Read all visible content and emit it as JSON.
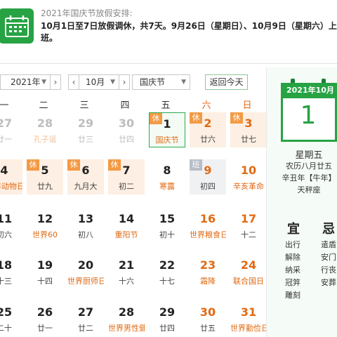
{
  "notice": {
    "title": "2021年国庆节放假安排:",
    "body": "10月1日至7日放假调休，共7天。9月26日（星期日）、10月9日（星期六）上班。"
  },
  "toolbar": {
    "year": "2021年",
    "month": "10月",
    "holiday": "国庆节",
    "today_label": "返回今天",
    "prev": "‹",
    "next": "›"
  },
  "weekdays": [
    "一",
    "二",
    "三",
    "四",
    "五",
    "六",
    "日"
  ],
  "weeks": [
    [
      {
        "day": "27",
        "lunar": "廿一",
        "dim": true
      },
      {
        "day": "28",
        "lunar": "孔子诞",
        "dim": true,
        "fest": true
      },
      {
        "day": "29",
        "lunar": "廿三",
        "dim": true
      },
      {
        "day": "30",
        "lunar": "廿四",
        "dim": true
      },
      {
        "day": "1",
        "lunar": "国庆节",
        "fest": true,
        "tag": "休",
        "today": true
      },
      {
        "day": "2",
        "lunar": "廿六",
        "tag": "休",
        "weekend": true
      },
      {
        "day": "3",
        "lunar": "廿七",
        "tag": "休",
        "weekend": true
      }
    ],
    [
      {
        "day": "4",
        "lunar": "世界动物日",
        "fest": true,
        "tag": "休"
      },
      {
        "day": "5",
        "lunar": "廿九",
        "tag": "休"
      },
      {
        "day": "6",
        "lunar": "九月大",
        "tag": "休"
      },
      {
        "day": "7",
        "lunar": "初二",
        "tag": "休"
      },
      {
        "day": "8",
        "lunar": "寒露",
        "fest": true
      },
      {
        "day": "9",
        "lunar": "初四",
        "tag": "班",
        "weekend": true,
        "work": true
      },
      {
        "day": "10",
        "lunar": "辛亥革命",
        "fest": true,
        "weekend": true
      }
    ],
    [
      {
        "day": "11",
        "lunar": "初六"
      },
      {
        "day": "12",
        "lunar": "世界60",
        "fest": true
      },
      {
        "day": "13",
        "lunar": "初八"
      },
      {
        "day": "14",
        "lunar": "重阳节",
        "fest": true
      },
      {
        "day": "15",
        "lunar": "初十"
      },
      {
        "day": "16",
        "lunar": "世界粮食日",
        "fest": true,
        "weekend": true
      },
      {
        "day": "17",
        "lunar": "十二",
        "weekend": true
      }
    ],
    [
      {
        "day": "18",
        "lunar": "十三"
      },
      {
        "day": "19",
        "lunar": "十四"
      },
      {
        "day": "20",
        "lunar": "世界厨师日",
        "fest": true
      },
      {
        "day": "21",
        "lunar": "十六"
      },
      {
        "day": "22",
        "lunar": "十七"
      },
      {
        "day": "23",
        "lunar": "霜降",
        "fest": true,
        "weekend": true
      },
      {
        "day": "24",
        "lunar": "联合国日",
        "fest": true,
        "weekend": true
      }
    ],
    [
      {
        "day": "25",
        "lunar": "二十"
      },
      {
        "day": "26",
        "lunar": "廿一"
      },
      {
        "day": "27",
        "lunar": "廿二"
      },
      {
        "day": "28",
        "lunar": "世界男性健康日",
        "fest": true
      },
      {
        "day": "29",
        "lunar": "廿四"
      },
      {
        "day": "30",
        "lunar": "廿五",
        "weekend": true
      },
      {
        "day": "31",
        "lunar": "世界勤俭日",
        "fest": true,
        "weekend": true
      }
    ]
  ],
  "detail": {
    "header": "2021年10月",
    "day": "1",
    "weekday": "星期五",
    "lunar": "农历八月廿五",
    "ganzhi": "辛丑年【牛年】",
    "zodiac": "天秤座",
    "yi_label": "宜",
    "ji_label": "忌",
    "yi": [
      "出行",
      "解除",
      "纳采",
      "冠笄",
      "雕刻"
    ],
    "ji": [
      "遣盾",
      "安门",
      "行丧",
      "安葬"
    ]
  },
  "colors": {
    "brand_green": "#27a344",
    "holiday_orange": "#e06a13",
    "holiday_bg": "#fdefe3"
  }
}
